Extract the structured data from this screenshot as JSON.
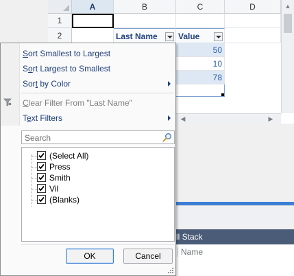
{
  "sheet": {
    "columns": [
      "A",
      "B",
      "C",
      "D"
    ],
    "rows": [
      "1",
      "2"
    ],
    "header_cells": [
      "Last Name",
      "Value"
    ],
    "values": [
      "50",
      "10",
      "78"
    ]
  },
  "menu": {
    "sort_asc": {
      "u": "S",
      "rest": "ort Smallest to Largest"
    },
    "sort_desc": {
      "pre": "S",
      "u": "o",
      "rest": "rt Largest to Smallest"
    },
    "sort_color": {
      "pre": "Sor",
      "u": "t",
      "rest": " by Color"
    },
    "clear_filter": {
      "u": "C",
      "rest": "lear Filter From \"Last Name\""
    },
    "text_filters": {
      "pre": "T",
      "u": "e",
      "rest": "xt Filters"
    }
  },
  "search": {
    "placeholder": "Search"
  },
  "filter_list": [
    {
      "label": "(Select All)",
      "checked": true
    },
    {
      "label": "Press",
      "checked": true
    },
    {
      "label": "Smith",
      "checked": true
    },
    {
      "label": "Vil",
      "checked": true
    },
    {
      "label": "(Blanks)",
      "checked": true
    }
  ],
  "buttons": {
    "ok": "OK",
    "cancel": "Cancel"
  },
  "call_stack": {
    "title": "ll Stack",
    "column": "Name"
  },
  "colors": {
    "accent": "#3c7fd6",
    "header_text": "#1f3f7a",
    "panel_title_bg": "#4a5c78"
  }
}
